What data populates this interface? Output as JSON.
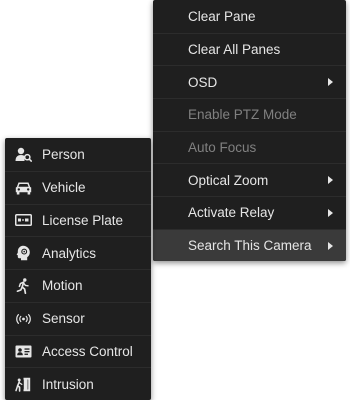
{
  "main_menu": {
    "items": [
      {
        "label": "Clear Pane",
        "disabled": false,
        "has_submenu": false
      },
      {
        "label": "Clear All Panes",
        "disabled": false,
        "has_submenu": false
      },
      {
        "label": "OSD",
        "disabled": false,
        "has_submenu": true
      },
      {
        "label": "Enable PTZ Mode",
        "disabled": true,
        "has_submenu": false
      },
      {
        "label": "Auto Focus",
        "disabled": true,
        "has_submenu": false
      },
      {
        "label": "Optical Zoom",
        "disabled": false,
        "has_submenu": true
      },
      {
        "label": "Activate Relay",
        "disabled": false,
        "has_submenu": true
      },
      {
        "label": "Search This Camera",
        "disabled": false,
        "has_submenu": true,
        "active": true
      }
    ]
  },
  "search_submenu": {
    "items": [
      {
        "label": "Person",
        "icon": "person-search-icon"
      },
      {
        "label": "Vehicle",
        "icon": "car-icon"
      },
      {
        "label": "License Plate",
        "icon": "license-plate-icon"
      },
      {
        "label": "Analytics",
        "icon": "analytics-head-icon"
      },
      {
        "label": "Motion",
        "icon": "running-person-icon"
      },
      {
        "label": "Sensor",
        "icon": "sensor-signal-icon"
      },
      {
        "label": "Access Control",
        "icon": "id-card-icon"
      },
      {
        "label": "Intrusion",
        "icon": "door-enter-icon"
      }
    ]
  },
  "colors": {
    "menu_background": "#1f1f1f",
    "text": "#e6e6e6",
    "disabled_text": "#808080",
    "active_background": "#3a3a3a"
  }
}
